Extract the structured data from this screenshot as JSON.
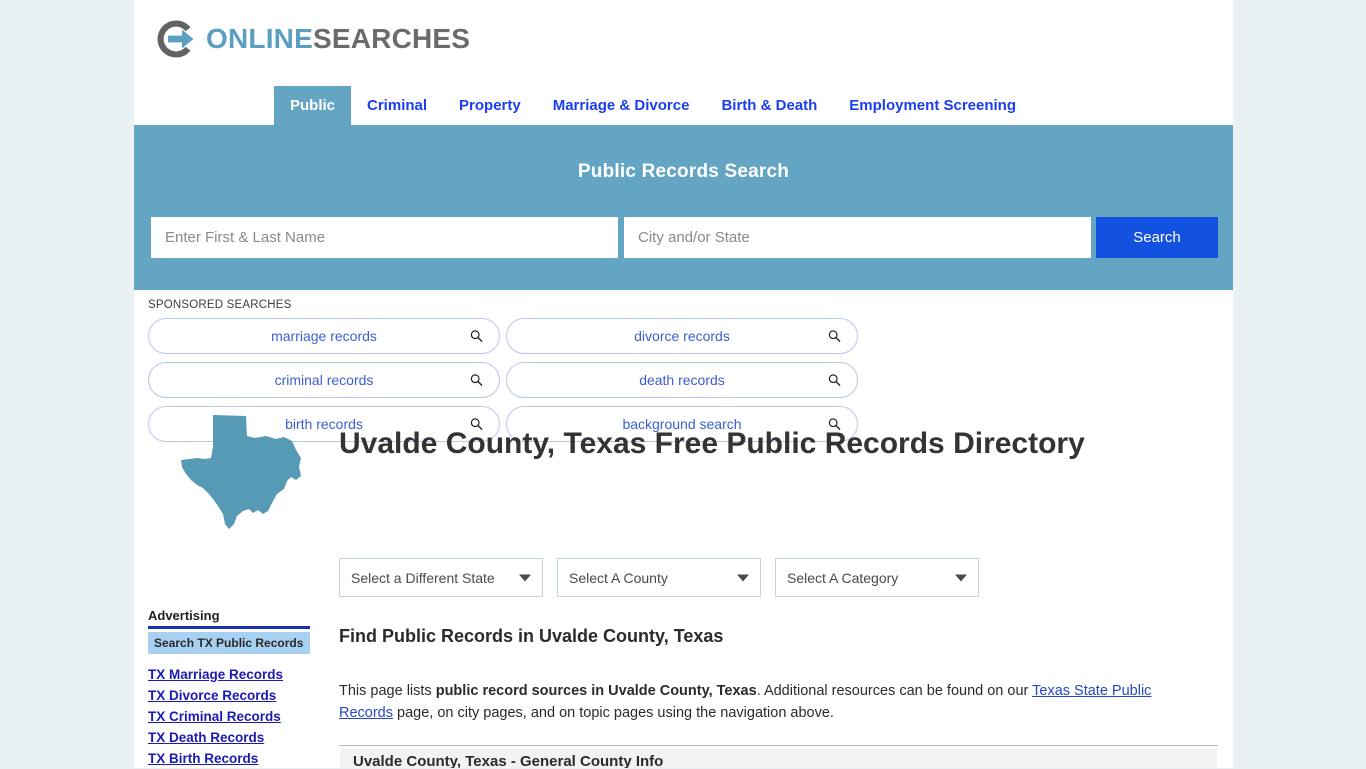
{
  "site": {
    "logo_primary": "ONLINE",
    "logo_secondary": "SEARCHES",
    "logo_icon": "circle-arrow-icon",
    "accent_teal": "#64a5c4",
    "accent_blue": "#1352e0",
    "link_blue": "#1a3ef0"
  },
  "nav": {
    "items": [
      {
        "label": "Public",
        "active": true
      },
      {
        "label": "Criminal",
        "active": false
      },
      {
        "label": "Property",
        "active": false
      },
      {
        "label": "Marriage & Divorce",
        "active": false
      },
      {
        "label": "Birth & Death",
        "active": false
      },
      {
        "label": "Employment Screening",
        "active": false
      }
    ]
  },
  "hero": {
    "title": "Public Records Search",
    "name_placeholder": "Enter First & Last Name",
    "name_value": "",
    "city_placeholder": "City and/or State",
    "city_value": "",
    "search_label": "Search"
  },
  "sponsored": {
    "label": "SPONSORED SEARCHES",
    "items": [
      {
        "label": "marriage records"
      },
      {
        "label": "divorce records"
      },
      {
        "label": "criminal records"
      },
      {
        "label": "death records"
      },
      {
        "label": "birth records"
      },
      {
        "label": "background search"
      }
    ]
  },
  "title_block": {
    "state_icon": "texas-state-outline-icon",
    "heading": "Uvalde County, Texas Free Public Records Directory"
  },
  "selects": {
    "state": {
      "value": "Select a Different State"
    },
    "county": {
      "value": "Select A County"
    },
    "category": {
      "value": "Select A Category"
    }
  },
  "sidebar": {
    "heading": "Advertising",
    "banner": "Search TX Public Records",
    "links": [
      {
        "label": "TX Marriage Records"
      },
      {
        "label": "TX Divorce Records"
      },
      {
        "label": "TX Criminal Records"
      },
      {
        "label": "TX Death Records"
      },
      {
        "label": "TX Birth Records"
      }
    ]
  },
  "main": {
    "subheading": "Find Public Records in Uvalde County, Texas",
    "paragraph": {
      "part1": "This page lists ",
      "bold1": "public record sources in Uvalde County, Texas",
      "part2": ". Additional resources can be found on our ",
      "link1": "Texas State Public Records",
      "part3": " page, on city pages, and on topic pages using the navigation above."
    },
    "section_heading": "Uvalde County, Texas - General County Info"
  }
}
